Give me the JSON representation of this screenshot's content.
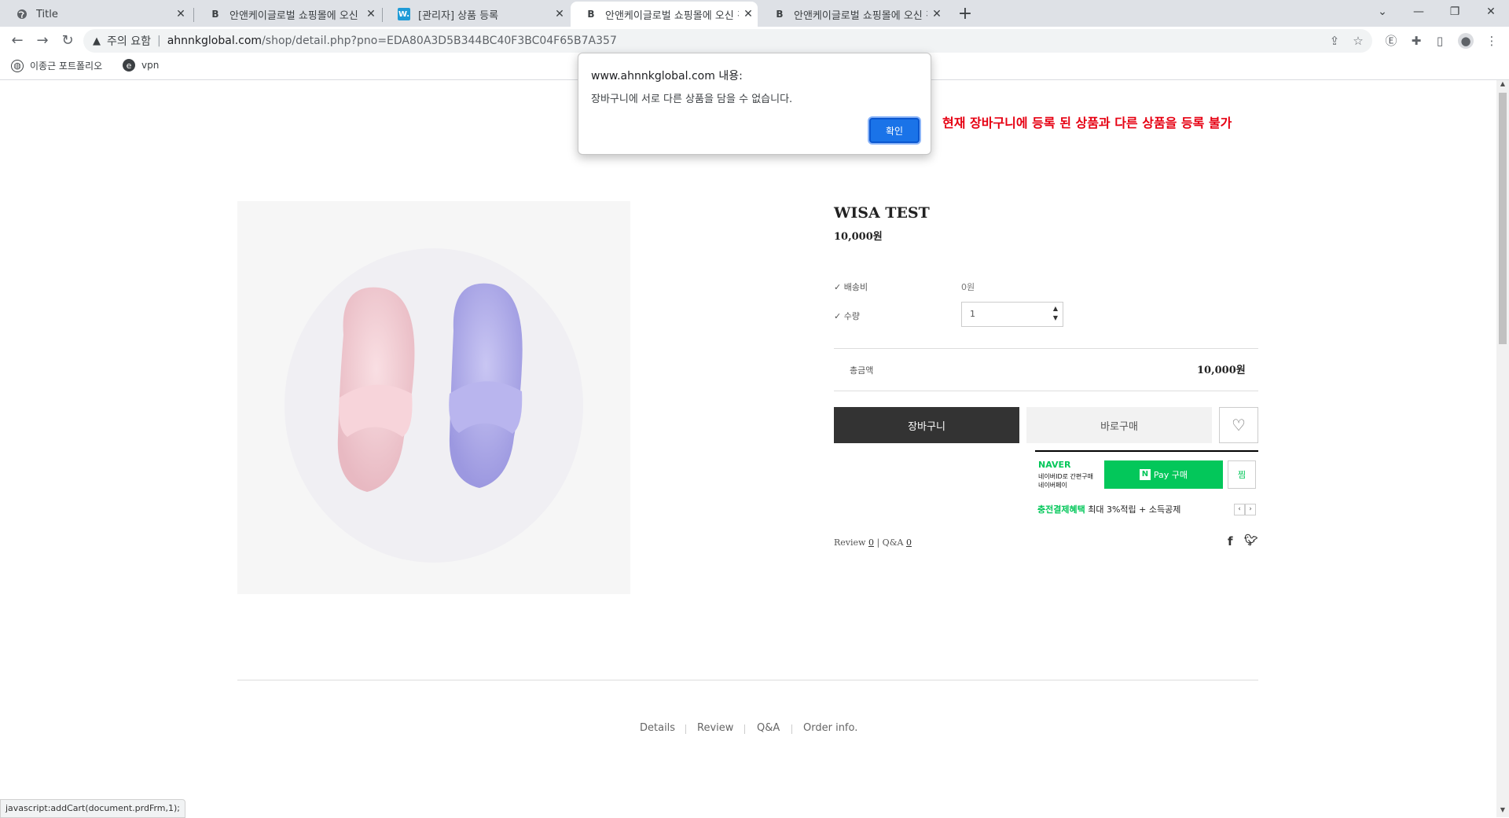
{
  "tabs": [
    {
      "title": "Title",
      "favicon": "globe-icon"
    },
    {
      "title": "안앤케이글로벌 쇼핑몰에 오신 것",
      "favicon": "b-logo-icon"
    },
    {
      "title": "[관리자] 상품 등록",
      "favicon": "w-logo-icon"
    },
    {
      "title": "안앤케이글로벌 쇼핑몰에 오신 것",
      "favicon": "b-logo-icon"
    },
    {
      "title": "안앤케이글로벌 쇼핑몰에 오신 것",
      "favicon": "b-logo-icon"
    }
  ],
  "address": {
    "warning": "주의 요함",
    "host": "ahnnkglobal.com",
    "path": "/shop/detail.php?pno=EDA80A3D5B344BC40F3BC04F65B7A357"
  },
  "bookmarks": [
    {
      "label": "이종근 포트폴리오",
      "icon": "globe-icon"
    },
    {
      "label": "vpn",
      "icon": "edge-icon"
    }
  ],
  "dialog": {
    "title": "www.ahnnkglobal.com 내용:",
    "message": "장바구니에 서로 다른 상품을 담을 수 없습니다.",
    "ok_label": "확인"
  },
  "annotation": "현재 장바구니에 등록 된 상품과 다른 상품을 등록 불가",
  "product": {
    "name": "WISA TEST",
    "price": "10,000원",
    "shipping_label": "✓ 배송비",
    "shipping_value": "0원",
    "qty_label": "✓ 수량",
    "qty_value": "1",
    "total_label": "총금액",
    "total_value": "10,000원",
    "cart_label": "장바구니",
    "buy_label": "바로구매"
  },
  "npay": {
    "brand": "NAVER",
    "line1": "네이버ID로 간편구매",
    "line2": "네이버페이",
    "pay_label": "Pay 구매",
    "jjim_label": "찜",
    "benefit_green": "충전결제혜택",
    "benefit_text": "최대 3%적립 + 소득공제"
  },
  "reviews": {
    "review_label": "Review",
    "review_count": "0",
    "sep": "|",
    "qna_label": "Q&A",
    "qna_count": "0"
  },
  "product_tabs": [
    "Details",
    "Review",
    "Q&A",
    "Order info."
  ],
  "status_url": "javascript:addCart(document.prdFrm,1);"
}
